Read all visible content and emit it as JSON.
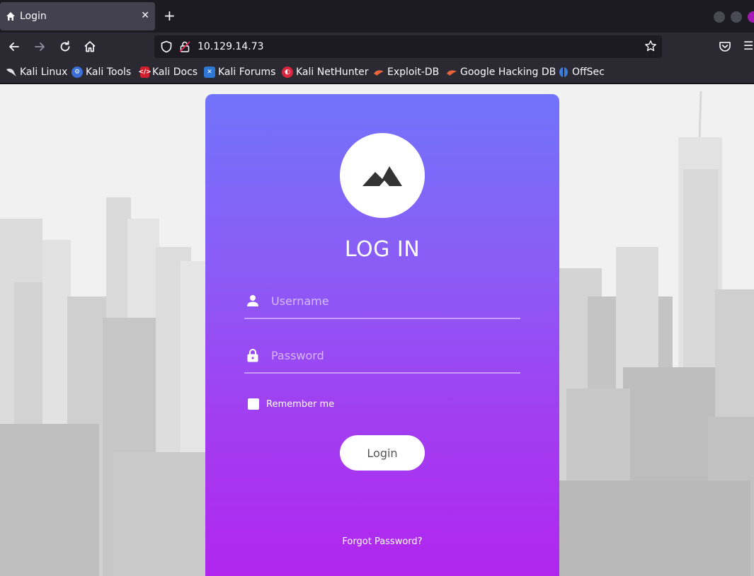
{
  "browser": {
    "tab_title": "Login",
    "url": "10.129.14.73",
    "bookmarks": [
      "Kali Linux",
      "Kali Tools",
      "Kali Docs",
      "Kali Forums",
      "Kali NetHunter",
      "Exploit-DB",
      "Google Hacking DB",
      "OffSec"
    ]
  },
  "login": {
    "title": "LOG IN",
    "username_placeholder": "Username",
    "password_placeholder": "Password",
    "remember_label": "Remember me",
    "login_button": "Login",
    "forgot_link": "Forgot Password?"
  },
  "icons": {
    "logo": "mountain-icon",
    "username": "user-icon",
    "password": "lock-icon"
  },
  "colors": {
    "gradient_top": "#7173fb",
    "gradient_bottom": "#b224ef",
    "button_bg": "#ffffff"
  }
}
